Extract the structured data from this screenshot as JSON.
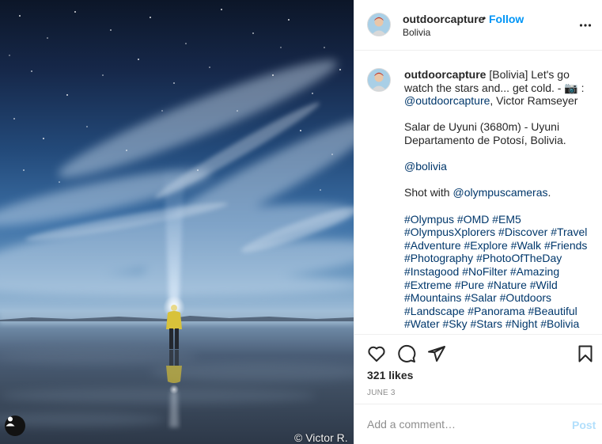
{
  "post": {
    "username": "outdoorcapture",
    "follow_label": "Follow",
    "dot": "•",
    "location": "Bolivia",
    "more_icon": "more-options-icon"
  },
  "photo": {
    "credit": "© Victor R.",
    "user_tag_icon": "user-tag-icon"
  },
  "caption": {
    "author": "outdoorcapture",
    "line1": "[Bolivia] Let's go watch the stars and... get cold. - 📷 :",
    "mention1": "@outdoorcapture",
    "line1_tail": ", Victor Ramseyer",
    "para2": "Salar de Uyuni (3680m) - Uyuni Departamento de Potosí, Bolivia.",
    "mention2": "@bolivia",
    "shot_with": "Shot with ",
    "mention3": "@olympuscameras",
    "shot_end": ".",
    "hashtags": [
      "#Olympus",
      "#OMD",
      "#EM5",
      "#OlympusXplorers",
      "#Discover",
      "#Travel",
      "#Adventure",
      "#Explore",
      "#Walk",
      "#Friends",
      "#Photography",
      "#PhotoOfTheDay",
      "#Instagood",
      "#NoFilter",
      "#Amazing",
      "#Extreme",
      "#Pure",
      "#Nature",
      "#Wild",
      "#Mountains",
      "#Salar",
      "#Outdoors",
      "#Landscape",
      "#Panorama",
      "#Beautiful",
      "#Water",
      "#Sky",
      "#Stars",
      "#Night",
      "#Bolivia"
    ]
  },
  "actions": {
    "likes": "321 likes",
    "date": "JUNE 3",
    "icons": [
      "heart-icon",
      "comment-icon",
      "share-icon",
      "bookmark-icon"
    ]
  },
  "comment_box": {
    "placeholder": "Add a comment…",
    "post_label": "Post"
  },
  "colors": {
    "accent": "#0095f6",
    "post_disabled": "#b2dffc",
    "link": "#00376b",
    "muted": "#8e8e8e",
    "border": "#efefef"
  }
}
